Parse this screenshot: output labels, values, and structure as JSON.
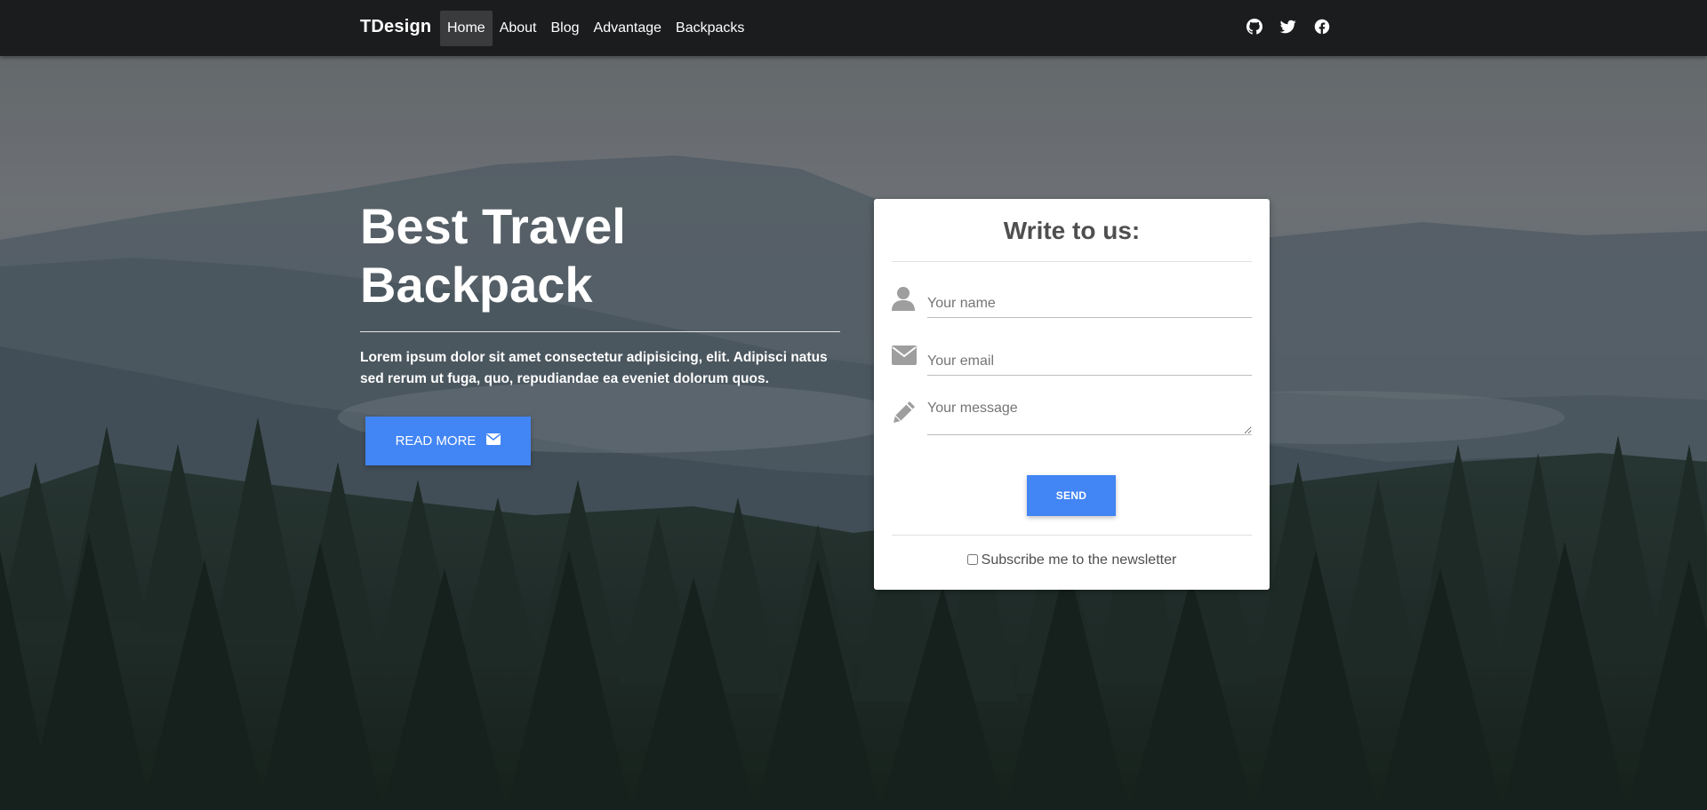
{
  "navbar": {
    "brand": "TDesign",
    "items": [
      {
        "label": "Home",
        "active": true
      },
      {
        "label": "About",
        "active": false
      },
      {
        "label": "Blog",
        "active": false
      },
      {
        "label": "Advantage",
        "active": false
      },
      {
        "label": "Backpacks",
        "active": false
      }
    ],
    "social_icons": [
      "github-icon",
      "twitter-icon",
      "facebook-icon"
    ]
  },
  "hero": {
    "title_line1": "Best Travel",
    "title_line2": "Backpack",
    "text": "Lorem ipsum dolor sit amet consectetur adipisicing, elit. Adipisci natus sed rerum ut fuga, quo, repudiandae ea eveniet dolorum quos.",
    "button_label": "READ MORE",
    "button_icon": "envelope-icon"
  },
  "form": {
    "title": "Write to us:",
    "name_placeholder": "Your name",
    "email_placeholder": "Your email",
    "message_placeholder": "Your message",
    "send_label": "SEND",
    "subscribe_label": "Subscribe me to the newsletter",
    "subscribe_checked": false,
    "icons": [
      "user-icon",
      "envelope-icon",
      "pencil-icon"
    ]
  },
  "colors": {
    "navbar_bg": "#1b1c1e",
    "accent": "#4285f4",
    "card_text": "#4f4f4f"
  }
}
